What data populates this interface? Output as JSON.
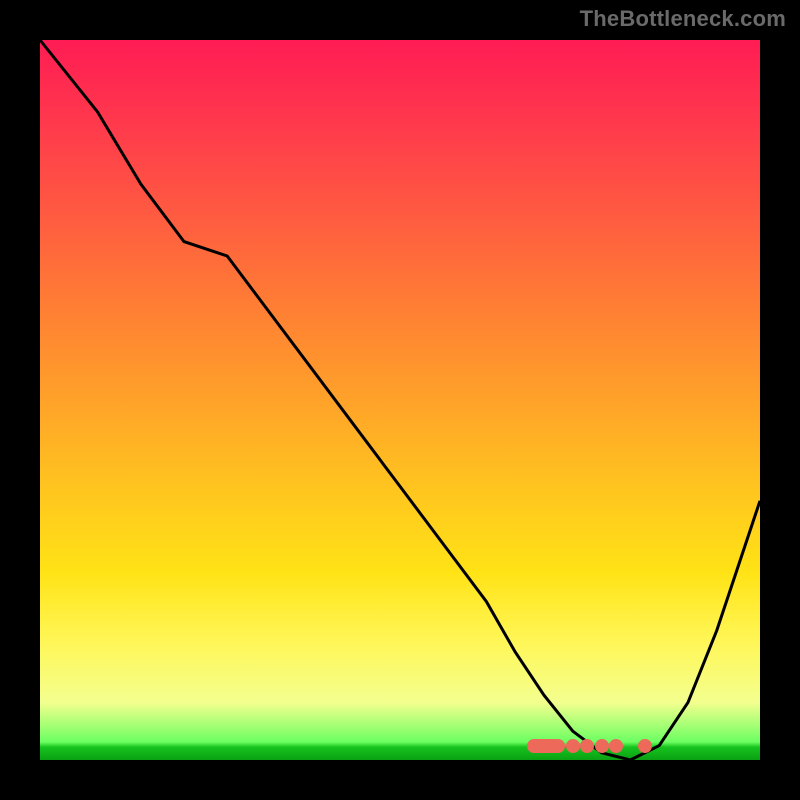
{
  "watermark": "TheBottleneck.com",
  "colors": {
    "background_black": "#000000",
    "curve": "#000000",
    "marker": "#ed6a5a",
    "gradient_top": "#ff1c54",
    "gradient_bottom": "#0aa013"
  },
  "chart_data": {
    "type": "line",
    "title": "",
    "xlabel": "",
    "ylabel": "",
    "xlim": [
      0,
      100
    ],
    "ylim": [
      0,
      100
    ],
    "grid": false,
    "legend": false,
    "series": [
      {
        "name": "bottleneck-curve",
        "x": [
          0,
          8,
          14,
          20,
          26,
          32,
          38,
          44,
          50,
          56,
          62,
          66,
          70,
          74,
          78,
          82,
          86,
          90,
          94,
          98,
          100
        ],
        "values": [
          100,
          90,
          80,
          72,
          70,
          62,
          54,
          46,
          38,
          30,
          22,
          15,
          9,
          4,
          1,
          0,
          2,
          8,
          18,
          30,
          36
        ]
      }
    ],
    "minimum_markers_x_pct": [
      70,
      72,
      74,
      76,
      78,
      80,
      84
    ],
    "minimum_markers_y_pct": 2
  }
}
